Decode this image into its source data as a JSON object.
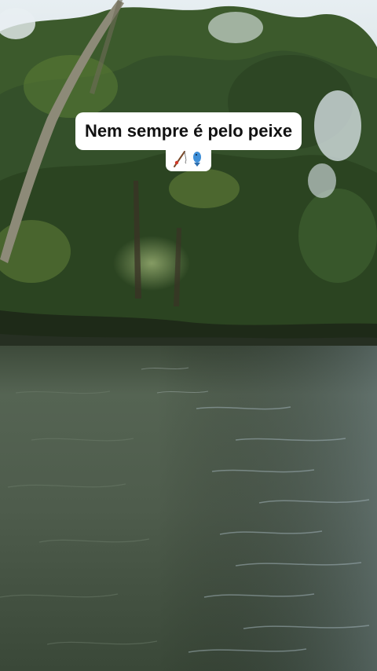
{
  "caption": {
    "line1": "Nem sempre é pelo peixe",
    "emoji_icons": [
      "fishing-pole-icon",
      "fish-icon"
    ]
  },
  "colors": {
    "caption_bg": "#ffffff",
    "caption_text": "#111111",
    "water": "#4a5a4a",
    "foliage": "#2f4a24",
    "sky": "#dfe8ee"
  }
}
